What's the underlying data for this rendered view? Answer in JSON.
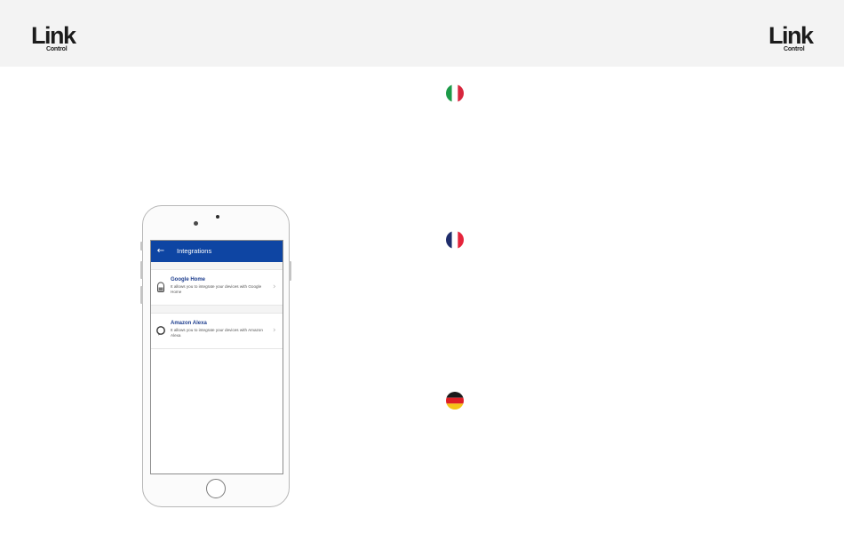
{
  "header": {
    "logo_left": {
      "word": "Link",
      "sub": "Control"
    },
    "logo_right": {
      "word": "Link",
      "sub": "Control"
    }
  },
  "phone": {
    "app_bar": {
      "back_icon": "arrow-left-icon",
      "title": "Integrations"
    },
    "integrations": [
      {
        "icon": "google-home-icon",
        "title": "Google Home",
        "description": "It allows you to integrate your devices with Google Home"
      },
      {
        "icon": "amazon-alexa-icon",
        "title": "Amazon Alexa",
        "description": "It allows you to integrate your devices with Amazon Alexa"
      }
    ],
    "accent_color": "#0e45a3"
  },
  "flags": [
    {
      "country": "italy",
      "icon": "italian-flag-icon"
    },
    {
      "country": "france",
      "icon": "french-flag-icon"
    },
    {
      "country": "germany",
      "icon": "german-flag-icon"
    }
  ]
}
